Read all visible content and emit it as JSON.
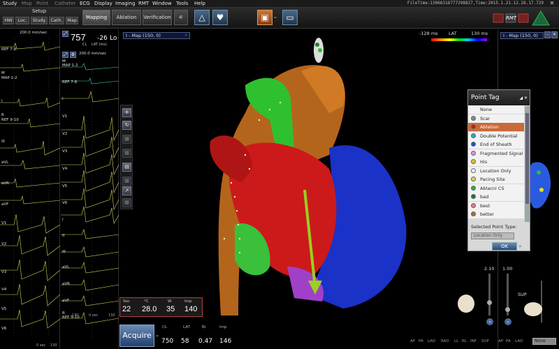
{
  "menu": {
    "items": [
      "Study",
      "Map",
      "Point",
      "Catheter",
      "ECG",
      "Display",
      "Imaging",
      "RMT",
      "Window",
      "Tools",
      "Help"
    ],
    "dim_items": [
      "Map",
      "Point",
      "Catheter"
    ]
  },
  "file_info": "FileTime:13066316777298827,Time:2015.1.21.12.26.17.729",
  "toolbar": {
    "setup_label": "Setup",
    "setup_buttons": [
      "HW",
      "Loc.",
      "Study",
      "Cath.",
      "Map"
    ],
    "modes": [
      "Mapping",
      "Ablation",
      "Verification"
    ],
    "active_mode": "Mapping",
    "logo_text": "RMT"
  },
  "ecg_left": {
    "speed": "200.0 mm/sec",
    "leads": [
      "REF 7-8",
      "M",
      "MAP 1-2",
      "I",
      "R",
      "REF 9-10",
      "III",
      "aVL",
      "aVR",
      "aVF",
      "V1",
      "V2",
      "V3",
      "V4",
      "V5",
      "V6"
    ],
    "footer_left": "0 sec",
    "footer_right": "130"
  },
  "ecg_right": {
    "cl_value": "757",
    "cl_label": "CL",
    "lat_label": "LAT (ms)",
    "lat_value": "-26",
    "lat_suffix": "Lo",
    "speed": "200.0 mm/sec",
    "leads": [
      "M",
      "MAP 1-2",
      "REF 7-8",
      "I",
      "V1",
      "V2",
      "V3",
      "V4",
      "V5",
      "V6",
      "I",
      "II",
      "III",
      "aVL",
      "aVR",
      "aVF",
      "R",
      "REF 9-10"
    ],
    "footer_left": "-130",
    "footer_mid": "0 sec",
    "footer_right": "130"
  },
  "map": {
    "selector": "I - Map (150, 0)",
    "lat_min": "-128 ms",
    "lat_label": "LAT",
    "lat_max": "130 ms"
  },
  "right_panel": {
    "selector": "I - Map (150, 0)"
  },
  "point_tag": {
    "title": "Point Tag",
    "items": [
      {
        "label": "None",
        "color": "#ffffff",
        "dot": false
      },
      {
        "label": "Scar",
        "color": "#888888",
        "dot": true
      },
      {
        "label": "Ablation",
        "color": "#b22222",
        "dot": true
      },
      {
        "label": "Double Potential",
        "color": "#2aa7c7",
        "dot": true
      },
      {
        "label": "End of Sheath",
        "color": "#1f4fd8",
        "dot": true
      },
      {
        "label": "Fragmented Signal",
        "color": "#e58ee8",
        "dot": true
      },
      {
        "label": "His",
        "color": "#e8c21a",
        "dot": true
      },
      {
        "label": "Location Only",
        "color": "#f5f5f5",
        "dot": true
      },
      {
        "label": "Pacing Site",
        "color": "#d9d93a",
        "dot": true
      },
      {
        "label": "Ablacni CS",
        "color": "#27b043",
        "dot": true
      },
      {
        "label": "bad",
        "color": "#1a7a2a",
        "dot": true
      },
      {
        "label": "best",
        "color": "#e67b8a",
        "dot": true
      },
      {
        "label": "better",
        "color": "#b06a2a",
        "dot": true
      }
    ],
    "selected": "Ablation",
    "selected_type_label": "Selected Point Type:",
    "selected_type_value": "Location Only",
    "ok_label": "OK",
    "more_label": "»"
  },
  "ablation": {
    "labels": [
      "Sec",
      "°C",
      "W",
      "Imp"
    ],
    "values": [
      "22",
      "28.0",
      "35",
      "140"
    ]
  },
  "acquire": {
    "label": "Acquire"
  },
  "bottom": {
    "labels": [
      "CL",
      "LAT",
      "Bi",
      "Imp"
    ],
    "values": [
      "750",
      "58",
      "0.47",
      "146"
    ]
  },
  "views": [
    "AP",
    "PA",
    "LAO",
    "RAO",
    "LL",
    "RL",
    "INF",
    "SUP",
    "AP",
    "PA",
    "LAO"
  ],
  "view_dropdown": "None",
  "sliders": {
    "left": "2.10",
    "right": "1.00"
  },
  "sup_label": "SUP"
}
